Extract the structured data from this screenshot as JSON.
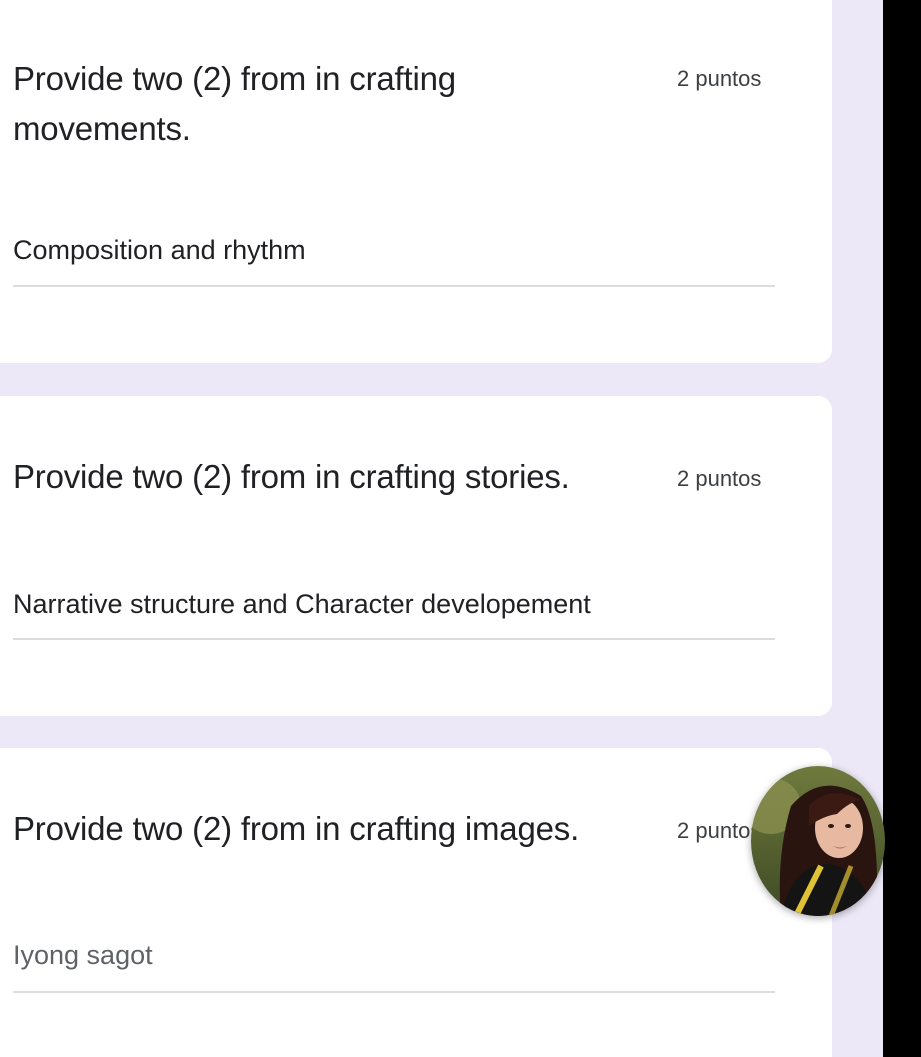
{
  "questions": [
    {
      "title": "Provide two (2) from in crafting movements.",
      "points": "2 puntos",
      "answer": "Composition and rhythm"
    },
    {
      "title": "Provide two (2) from in crafting stories.",
      "points": "2 puntos",
      "answer": "Narrative structure and Character developement"
    },
    {
      "title": "Provide two (2) from in crafting images.",
      "points": "2 puntos",
      "answer_placeholder": "Iyong sagot"
    }
  ],
  "colors": {
    "background": "#ede8f7",
    "card": "#ffffff",
    "text": "#202124",
    "underline": "#dadce0"
  },
  "icons": {
    "avatar": "user-avatar-photo"
  }
}
